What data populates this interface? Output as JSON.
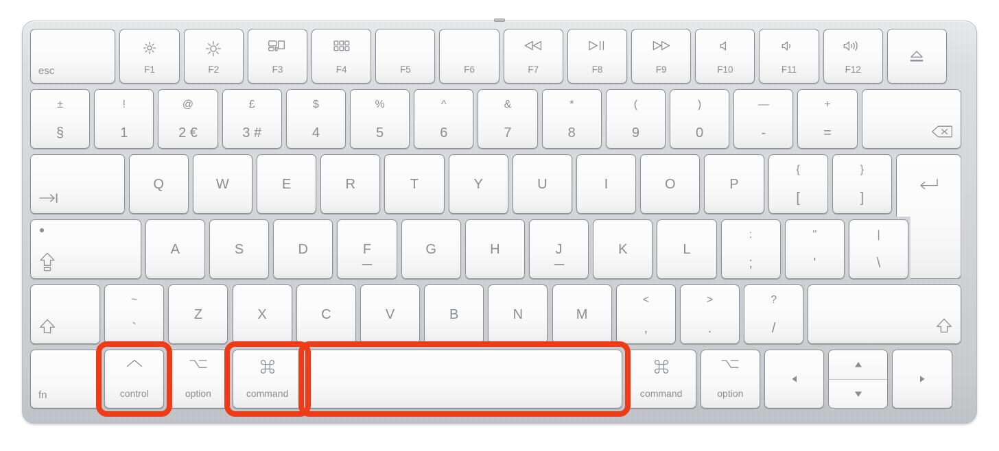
{
  "device": {
    "name": "Apple Magic Keyboard",
    "layout": "UK / ISO",
    "body_color": "#d5d7db",
    "key_color": "#fafafa",
    "legend_color": "#8a8d91",
    "highlight_color": "#ee3b18"
  },
  "highlights": [
    {
      "label": "control",
      "target": "control-key"
    },
    {
      "label": "command",
      "target": "command-left-key"
    },
    {
      "label": "space",
      "target": "space-key"
    }
  ],
  "rows": [
    {
      "id": "function-row",
      "keys": [
        {
          "name": "esc-key",
          "style": "corner-bl",
          "bottom_left": "esc"
        },
        {
          "name": "f1-key",
          "style": "fn",
          "glyph": "brightness-down-icon",
          "sub": "F1"
        },
        {
          "name": "f2-key",
          "style": "fn",
          "glyph": "brightness-up-icon",
          "sub": "F2"
        },
        {
          "name": "f3-key",
          "style": "fn",
          "glyph": "mission-control-icon",
          "sub": "F3"
        },
        {
          "name": "f4-key",
          "style": "fn",
          "glyph": "launchpad-icon",
          "sub": "F4"
        },
        {
          "name": "f5-key",
          "style": "fn",
          "glyph": "",
          "sub": "F5"
        },
        {
          "name": "f6-key",
          "style": "fn",
          "glyph": "",
          "sub": "F6"
        },
        {
          "name": "f7-key",
          "style": "fn",
          "glyph": "rewind-icon",
          "sub": "F7"
        },
        {
          "name": "f8-key",
          "style": "fn",
          "glyph": "play-pause-icon",
          "sub": "F8"
        },
        {
          "name": "f9-key",
          "style": "fn",
          "glyph": "fast-forward-icon",
          "sub": "F9"
        },
        {
          "name": "f10-key",
          "style": "fn",
          "glyph": "volume-mute-icon",
          "sub": "F10"
        },
        {
          "name": "f11-key",
          "style": "fn",
          "glyph": "volume-down-icon",
          "sub": "F11"
        },
        {
          "name": "f12-key",
          "style": "fn",
          "glyph": "volume-up-icon",
          "sub": "F12"
        },
        {
          "name": "eject-key",
          "style": "icon-center",
          "glyph": "eject-icon"
        }
      ]
    },
    {
      "id": "number-row",
      "keys": [
        {
          "name": "section-key",
          "style": "dual",
          "top": "±",
          "bottom": "§"
        },
        {
          "name": "one-key",
          "style": "dual",
          "top": "!",
          "bottom": "1"
        },
        {
          "name": "two-key",
          "style": "dual",
          "top": "@",
          "bottom": "2 €"
        },
        {
          "name": "three-key",
          "style": "dual",
          "top": "£",
          "bottom": "3 #"
        },
        {
          "name": "four-key",
          "style": "dual",
          "top": "$",
          "bottom": "4"
        },
        {
          "name": "five-key",
          "style": "dual",
          "top": "%",
          "bottom": "5"
        },
        {
          "name": "six-key",
          "style": "dual",
          "top": "^",
          "bottom": "6"
        },
        {
          "name": "seven-key",
          "style": "dual",
          "top": "&",
          "bottom": "7"
        },
        {
          "name": "eight-key",
          "style": "dual",
          "top": "*",
          "bottom": "8"
        },
        {
          "name": "nine-key",
          "style": "dual",
          "top": "(",
          "bottom": "9"
        },
        {
          "name": "zero-key",
          "style": "dual",
          "top": ")",
          "bottom": "0"
        },
        {
          "name": "minus-key",
          "style": "dual",
          "top": "—",
          "bottom": "-"
        },
        {
          "name": "equals-key",
          "style": "dual",
          "top": "+",
          "bottom": "="
        },
        {
          "name": "delete-key",
          "style": "icon-br",
          "glyph": "delete-backspace-icon"
        }
      ]
    },
    {
      "id": "top-letter-row",
      "keys": [
        {
          "name": "tab-key",
          "style": "icon-bl",
          "glyph": "tab-icon"
        },
        {
          "name": "q-key",
          "style": "alpha",
          "label": "Q"
        },
        {
          "name": "w-key",
          "style": "alpha",
          "label": "W"
        },
        {
          "name": "e-key",
          "style": "alpha",
          "label": "E"
        },
        {
          "name": "r-key",
          "style": "alpha",
          "label": "R"
        },
        {
          "name": "t-key",
          "style": "alpha",
          "label": "T"
        },
        {
          "name": "y-key",
          "style": "alpha",
          "label": "Y"
        },
        {
          "name": "u-key",
          "style": "alpha",
          "label": "U"
        },
        {
          "name": "i-key",
          "style": "alpha",
          "label": "I"
        },
        {
          "name": "o-key",
          "style": "alpha",
          "label": "O"
        },
        {
          "name": "p-key",
          "style": "alpha",
          "label": "P"
        },
        {
          "name": "bracket-left-key",
          "style": "dual",
          "top": "{",
          "bottom": "["
        },
        {
          "name": "bracket-right-key",
          "style": "dual",
          "top": "}",
          "bottom": "]"
        },
        {
          "name": "return-key",
          "style": "iso-return",
          "glyph": "return-icon"
        }
      ]
    },
    {
      "id": "home-row",
      "keys": [
        {
          "name": "caps-lock-key",
          "style": "caps",
          "glyph": "caps-lock-icon"
        },
        {
          "name": "a-key",
          "style": "alpha",
          "label": "A"
        },
        {
          "name": "s-key",
          "style": "alpha",
          "label": "S"
        },
        {
          "name": "d-key",
          "style": "alpha",
          "label": "D"
        },
        {
          "name": "f-key",
          "style": "alpha",
          "label": "F",
          "homing": true
        },
        {
          "name": "g-key",
          "style": "alpha",
          "label": "G"
        },
        {
          "name": "h-key",
          "style": "alpha",
          "label": "H"
        },
        {
          "name": "j-key",
          "style": "alpha",
          "label": "J",
          "homing": true
        },
        {
          "name": "k-key",
          "style": "alpha",
          "label": "K"
        },
        {
          "name": "l-key",
          "style": "alpha",
          "label": "L"
        },
        {
          "name": "semicolon-key",
          "style": "dual",
          "top": ":",
          "bottom": ";"
        },
        {
          "name": "quote-key",
          "style": "dual",
          "top": "\"",
          "bottom": "'"
        },
        {
          "name": "backslash-key",
          "style": "dual",
          "top": "|",
          "bottom": "\\"
        }
      ]
    },
    {
      "id": "bottom-letter-row",
      "keys": [
        {
          "name": "shift-left-key",
          "style": "icon-bl",
          "glyph": "shift-icon"
        },
        {
          "name": "backtick-key",
          "style": "dual",
          "top": "~",
          "bottom": "`"
        },
        {
          "name": "z-key",
          "style": "alpha",
          "label": "Z"
        },
        {
          "name": "x-key",
          "style": "alpha",
          "label": "X"
        },
        {
          "name": "c-key",
          "style": "alpha",
          "label": "C"
        },
        {
          "name": "v-key",
          "style": "alpha",
          "label": "V"
        },
        {
          "name": "b-key",
          "style": "alpha",
          "label": "B"
        },
        {
          "name": "n-key",
          "style": "alpha",
          "label": "N"
        },
        {
          "name": "m-key",
          "style": "alpha",
          "label": "M"
        },
        {
          "name": "comma-key",
          "style": "dual",
          "top": "<",
          "bottom": ","
        },
        {
          "name": "period-key",
          "style": "dual",
          "top": ">",
          "bottom": "."
        },
        {
          "name": "slash-key",
          "style": "dual",
          "top": "?",
          "bottom": "/"
        },
        {
          "name": "shift-right-key",
          "style": "icon-br",
          "glyph": "shift-icon"
        }
      ]
    },
    {
      "id": "modifier-row",
      "keys": [
        {
          "name": "fn-key",
          "style": "corner-bl",
          "bottom_left": "fn"
        },
        {
          "name": "control-key",
          "style": "mod",
          "glyph": "control-icon",
          "sub": "control"
        },
        {
          "name": "option-left-key",
          "style": "mod",
          "glyph": "option-icon",
          "sub": "option"
        },
        {
          "name": "command-left-key",
          "style": "mod",
          "glyph": "command-icon",
          "sub": "command"
        },
        {
          "name": "space-key",
          "style": "blank"
        },
        {
          "name": "command-right-key",
          "style": "mod",
          "glyph": "command-icon",
          "sub": "command"
        },
        {
          "name": "option-right-key",
          "style": "mod",
          "glyph": "option-icon",
          "sub": "option"
        },
        {
          "name": "arrow-left-key",
          "style": "icon-center-small",
          "glyph": "arrow-left-icon"
        },
        {
          "name": "arrow-updown-key",
          "style": "updown",
          "glyph_up": "arrow-up-icon",
          "glyph_down": "arrow-down-icon"
        },
        {
          "name": "arrow-right-key",
          "style": "icon-center-small",
          "glyph": "arrow-right-icon"
        }
      ]
    }
  ]
}
